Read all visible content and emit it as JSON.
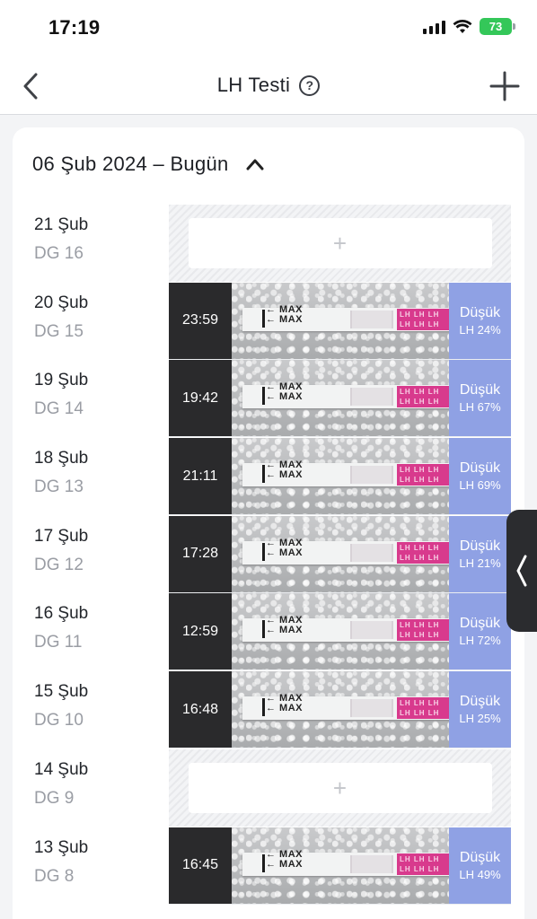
{
  "status_bar": {
    "time": "17:19",
    "battery": "73"
  },
  "nav": {
    "title": "LH Testi",
    "help": "?"
  },
  "card": {
    "title": "06 Şub 2024 – Bugün"
  },
  "entries": [
    {
      "date": "21 Şub",
      "day": "DG 16",
      "empty": true
    },
    {
      "date": "20 Şub",
      "day": "DG 15",
      "empty": false,
      "time": "23:59",
      "result": "Düşük",
      "percent": "LH 24%"
    },
    {
      "date": "19 Şub",
      "day": "DG 14",
      "empty": false,
      "time": "19:42",
      "result": "Düşük",
      "percent": "LH 67%"
    },
    {
      "date": "18 Şub",
      "day": "DG 13",
      "empty": false,
      "time": "21:11",
      "result": "Düşük",
      "percent": "LH 69%"
    },
    {
      "date": "17 Şub",
      "day": "DG 12",
      "empty": false,
      "time": "17:28",
      "result": "Düşük",
      "percent": "LH 21%"
    },
    {
      "date": "16 Şub",
      "day": "DG 11",
      "empty": false,
      "time": "12:59",
      "result": "Düşük",
      "percent": "LH 72%"
    },
    {
      "date": "15 Şub",
      "day": "DG 10",
      "empty": false,
      "time": "16:48",
      "result": "Düşük",
      "percent": "LH 25%"
    },
    {
      "date": "14 Şub",
      "day": "DG 9",
      "empty": true
    },
    {
      "date": "13 Şub",
      "day": "DG 8",
      "empty": false,
      "time": "16:45",
      "result": "Düşük",
      "percent": "LH 49%"
    }
  ],
  "strip": {
    "max_label": "← MAX\n← MAX",
    "pink_label": "LH LH LH\nLH LH LH"
  },
  "colors": {
    "accent": "#8fa1e4",
    "strip_pink": "#d83a8d",
    "battery": "#34c759"
  },
  "icons": {
    "back": "chevron-left-icon",
    "help": "question-circle-icon",
    "add": "plus-icon",
    "collapse": "chevron-up-icon",
    "side": "chevron-left-icon",
    "slot_add": "plus-icon"
  }
}
